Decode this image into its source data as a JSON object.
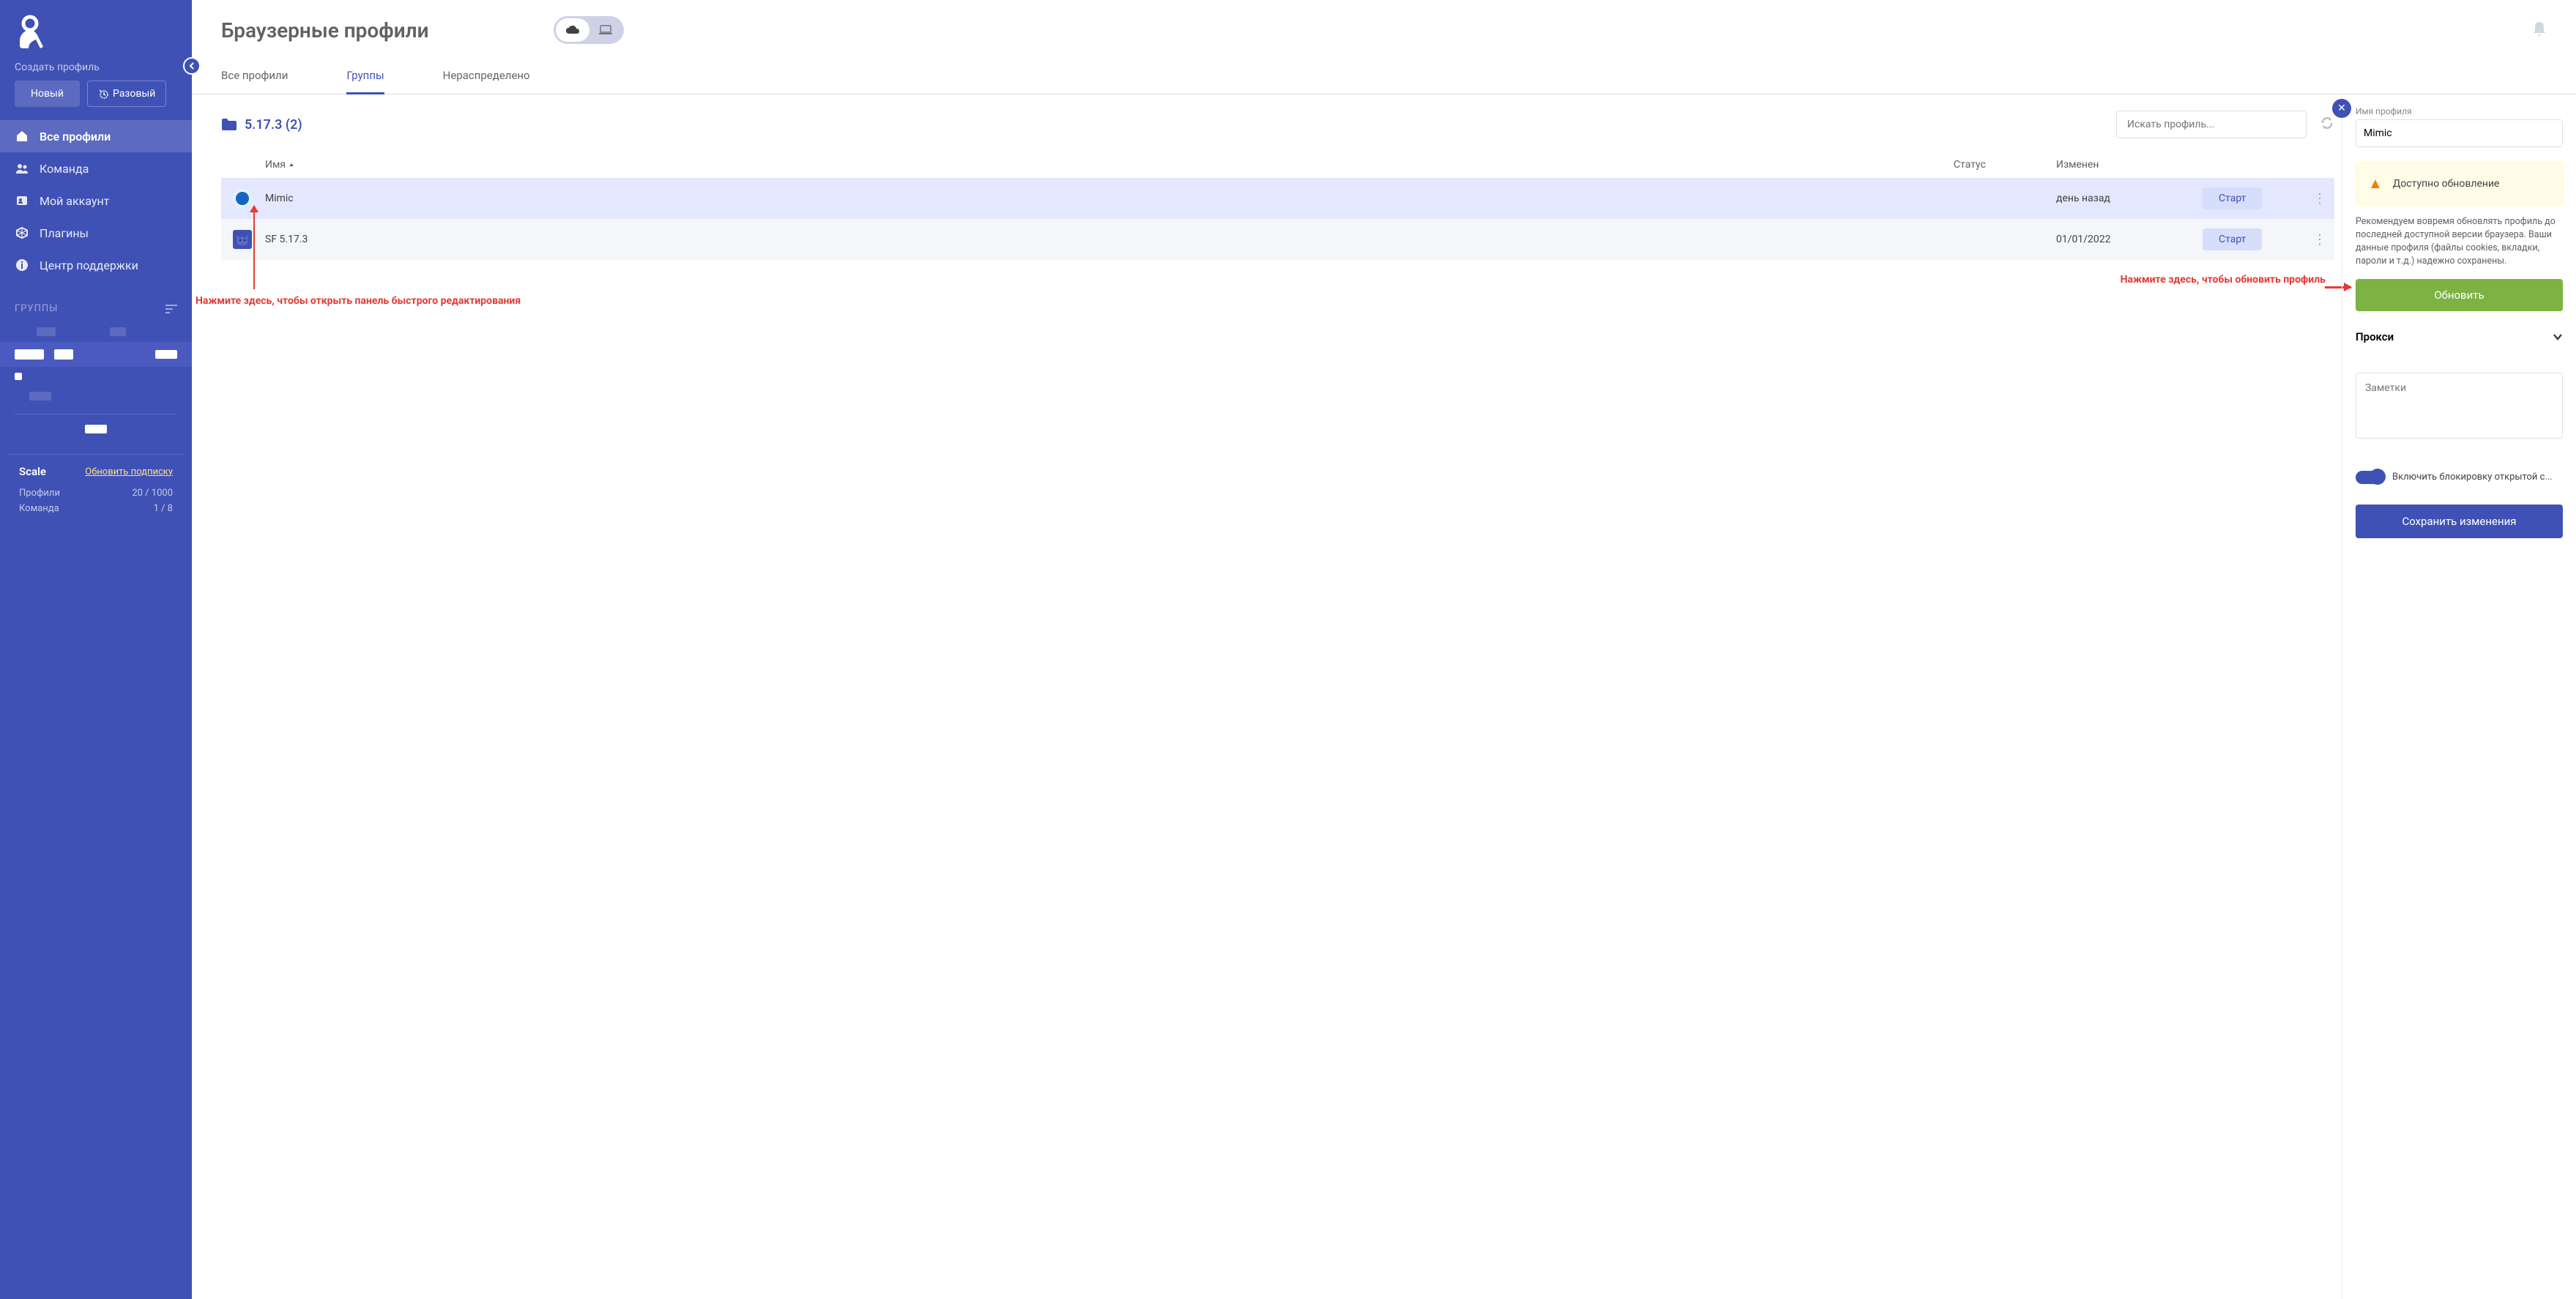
{
  "sidebar": {
    "create_label": "Создать профиль",
    "new_btn": "Новый",
    "once_btn": "Разовый",
    "nav": [
      {
        "icon": "home",
        "label": "Все профили",
        "active": true
      },
      {
        "icon": "team",
        "label": "Команда"
      },
      {
        "icon": "account",
        "label": "Мой аккаунт"
      },
      {
        "icon": "plugins",
        "label": "Плагины"
      },
      {
        "icon": "help",
        "label": "Центр поддержки"
      }
    ],
    "groups_header": "ГРУППЫ",
    "subscription": {
      "plan": "Scale",
      "link": "Обновить подписку",
      "profiles_label": "Профили",
      "profiles_value": "20 / 1000",
      "team_label": "Команда",
      "team_value": "1 / 8"
    }
  },
  "header": {
    "title": "Браузерные профили"
  },
  "tabs": [
    {
      "label": "Все профили"
    },
    {
      "label": "Группы",
      "active": true
    },
    {
      "label": "Нераспределено"
    }
  ],
  "group": {
    "name": "5.17.3 (2)"
  },
  "search_placeholder": "Искать профиль...",
  "columns": {
    "name": "Имя",
    "status": "Статус",
    "changed": "Изменен"
  },
  "rows": [
    {
      "name": "Mimic",
      "status": "",
      "changed": "день назад",
      "action": "Старт",
      "selected": true,
      "icon": "blue"
    },
    {
      "name": "SF 5.17.3",
      "status": "",
      "changed": "01/01/2022",
      "action": "Старт",
      "icon": "fox"
    }
  ],
  "panel": {
    "name_label": "Имя профиля",
    "name_value": "Mimic",
    "alert": "Доступно обновление",
    "desc": "Рекомендуем вовремя обновлять профиль до последней доступной версии браузера. Ваши данные профиля (файлы cookies, вкладки, пароли и т.д.) надежно сохранены.",
    "update_btn": "Обновить",
    "proxy": "Прокси",
    "notes_placeholder": "Заметки",
    "block_label": "Включить блокировку открытой с...",
    "save_btn": "Сохранить изменения"
  },
  "annotations": {
    "edit": "Нажмите здесь, чтобы открыть панель быстрого редактирования",
    "update": "Нажмите здесь, чтобы обновить профиль"
  }
}
